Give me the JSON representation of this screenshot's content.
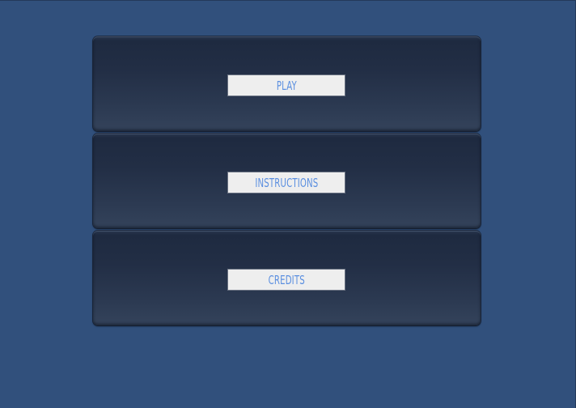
{
  "menu": {
    "buttons": [
      {
        "label": "PLAY"
      },
      {
        "label": "INSTRUCTIONS"
      },
      {
        "label": "CREDITS"
      }
    ]
  },
  "colors": {
    "background": "#31507c",
    "panel": "#222e45",
    "button_bg": "#eeeeee",
    "button_text": "#5b8fe0"
  }
}
